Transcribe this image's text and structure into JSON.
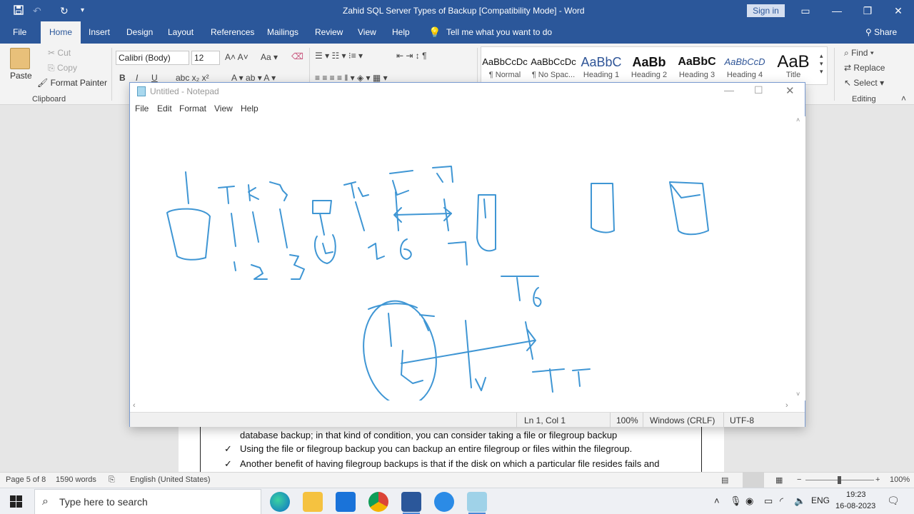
{
  "word": {
    "title": "Zahid SQL Server Types of Backup [Compatibility Mode]  -  Word",
    "sign_in": "Sign in",
    "tabs": [
      "File",
      "Home",
      "Insert",
      "Design",
      "Layout",
      "References",
      "Mailings",
      "Review",
      "View",
      "Help"
    ],
    "tell_me": "Tell me what you want to do",
    "share": "Share",
    "clipboard": {
      "paste": "Paste",
      "cut": "Cut",
      "copy": "Copy",
      "format_painter": "Format Painter",
      "group": "Clipboard"
    },
    "font": {
      "name": "Calibri (Body)",
      "size": "12"
    },
    "styles": [
      {
        "preview": "AaBbCcDc",
        "name": "¶ Normal"
      },
      {
        "preview": "AaBbCcDc",
        "name": "¶ No Spac..."
      },
      {
        "preview": "AaBbC",
        "name": "Heading 1"
      },
      {
        "preview": "AaBb",
        "name": "Heading 2"
      },
      {
        "preview": "AaBbC",
        "name": "Heading 3"
      },
      {
        "preview": "AaBbCcD",
        "name": "Heading 4"
      },
      {
        "preview": "AaB",
        "name": "Title"
      }
    ],
    "editing": {
      "find": "Find",
      "replace": "Replace",
      "select": "Select",
      "group": "Editing"
    },
    "doc_lines": [
      "database backup; in that kind of condition, you can consider taking a file or filegroup backup",
      "Using the file or filegroup backup you can backup an entire filegroup or files within the filegroup.",
      "Another benefit of having filegroup backups is that if the disk on which a particular file resides fails and"
    ],
    "status": {
      "page": "Page 5 of 8",
      "words": "1590 words",
      "language": "English (United States)",
      "zoom": "100%"
    }
  },
  "notepad": {
    "title": "Untitled - Notepad",
    "menu": [
      "File",
      "Edit",
      "Format",
      "View",
      "Help"
    ],
    "status": {
      "position": "Ln 1, Col 1",
      "zoom": "100%",
      "line_ending": "Windows (CRLF)",
      "encoding": "UTF-8"
    }
  },
  "taskbar": {
    "search_placeholder": "Type here to search",
    "language": "ENG",
    "time": "19:23",
    "date": "16-08-2023"
  },
  "colors": {
    "word_blue": "#2b579a",
    "ink": "#3f96d4"
  }
}
